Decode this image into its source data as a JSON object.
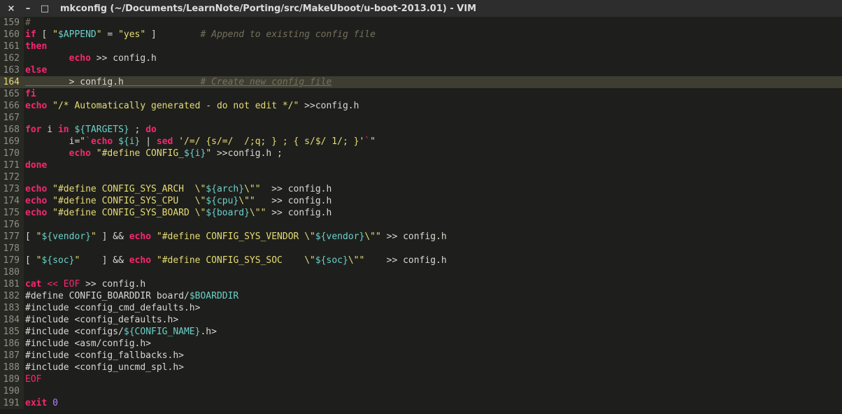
{
  "titlebar": {
    "close": "×",
    "min": "–",
    "max": "□",
    "title": "mkconfig (~/Documents/LearnNote/Porting/src/MakeUboot/u-boot-2013.01) - VIM"
  },
  "current_line": 164,
  "lines": [
    {
      "n": 159,
      "tokens": [
        [
          "cmt",
          "#"
        ]
      ]
    },
    {
      "n": 160,
      "tokens": [
        [
          "kw",
          "if"
        ],
        [
          "punct",
          " [ "
        ],
        [
          "str",
          "\""
        ],
        [
          "var",
          "$APPEND"
        ],
        [
          "str",
          "\""
        ],
        [
          "punct",
          " = "
        ],
        [
          "str",
          "\"yes\""
        ],
        [
          "punct",
          " ]        "
        ],
        [
          "cmt",
          "# Append to existing config file"
        ]
      ]
    },
    {
      "n": 161,
      "tokens": [
        [
          "kw",
          "then"
        ]
      ]
    },
    {
      "n": 162,
      "tokens": [
        [
          "punct",
          "        "
        ],
        [
          "kw",
          "echo"
        ],
        [
          "punct",
          " >> config.h"
        ]
      ]
    },
    {
      "n": 163,
      "tokens": [
        [
          "kw",
          "else"
        ]
      ]
    },
    {
      "n": 164,
      "tokens": [
        [
          "punct",
          "        > config.h              "
        ],
        [
          "cmt",
          "# Create new config file"
        ]
      ]
    },
    {
      "n": 165,
      "tokens": [
        [
          "kw",
          "fi"
        ]
      ]
    },
    {
      "n": 166,
      "tokens": [
        [
          "kw",
          "echo"
        ],
        [
          "punct",
          " "
        ],
        [
          "str",
          "\"/* Automatically generated - do not edit */\""
        ],
        [
          "punct",
          " >>config.h"
        ]
      ]
    },
    {
      "n": 167,
      "tokens": []
    },
    {
      "n": 168,
      "tokens": [
        [
          "kw",
          "for"
        ],
        [
          "punct",
          " i "
        ],
        [
          "kw",
          "in"
        ],
        [
          "punct",
          " "
        ],
        [
          "var",
          "${TARGETS}"
        ],
        [
          "punct",
          " ; "
        ],
        [
          "kw",
          "do"
        ]
      ]
    },
    {
      "n": 169,
      "tokens": [
        [
          "punct",
          "        i="
        ],
        [
          "str",
          "\""
        ],
        [
          "red",
          "`"
        ],
        [
          "kw",
          "echo"
        ],
        [
          "punct",
          " "
        ],
        [
          "var",
          "${i}"
        ],
        [
          "punct",
          " | "
        ],
        [
          "kw",
          "sed"
        ],
        [
          "punct",
          " "
        ],
        [
          "str",
          "'/=/ {s/=/\t/;q; } ; { s/$/ 1/; }'"
        ],
        [
          "red",
          "`"
        ],
        [
          "str",
          "\""
        ]
      ]
    },
    {
      "n": 170,
      "tokens": [
        [
          "punct",
          "        "
        ],
        [
          "kw",
          "echo"
        ],
        [
          "punct",
          " "
        ],
        [
          "str",
          "\"#define CONFIG_"
        ],
        [
          "var",
          "${i}"
        ],
        [
          "str",
          "\""
        ],
        [
          "punct",
          " >>config.h ;"
        ]
      ]
    },
    {
      "n": 171,
      "tokens": [
        [
          "kw",
          "done"
        ]
      ]
    },
    {
      "n": 172,
      "tokens": []
    },
    {
      "n": 173,
      "tokens": [
        [
          "kw",
          "echo"
        ],
        [
          "punct",
          " "
        ],
        [
          "str",
          "\"#define CONFIG_SYS_ARCH  \\\""
        ],
        [
          "var",
          "${arch}"
        ],
        [
          "str",
          "\\\"\""
        ],
        [
          "punct",
          "  >> config.h"
        ]
      ]
    },
    {
      "n": 174,
      "tokens": [
        [
          "kw",
          "echo"
        ],
        [
          "punct",
          " "
        ],
        [
          "str",
          "\"#define CONFIG_SYS_CPU   \\\""
        ],
        [
          "var",
          "${cpu}"
        ],
        [
          "str",
          "\\\"\""
        ],
        [
          "punct",
          "   >> config.h"
        ]
      ]
    },
    {
      "n": 175,
      "tokens": [
        [
          "kw",
          "echo"
        ],
        [
          "punct",
          " "
        ],
        [
          "str",
          "\"#define CONFIG_SYS_BOARD \\\""
        ],
        [
          "var",
          "${board}"
        ],
        [
          "str",
          "\\\"\""
        ],
        [
          "punct",
          " >> config.h"
        ]
      ]
    },
    {
      "n": 176,
      "tokens": []
    },
    {
      "n": 177,
      "tokens": [
        [
          "punct",
          "[ "
        ],
        [
          "str",
          "\""
        ],
        [
          "var",
          "${vendor}"
        ],
        [
          "str",
          "\""
        ],
        [
          "punct",
          " ] && "
        ],
        [
          "kw",
          "echo"
        ],
        [
          "punct",
          " "
        ],
        [
          "str",
          "\"#define CONFIG_SYS_VENDOR \\\""
        ],
        [
          "var",
          "${vendor}"
        ],
        [
          "str",
          "\\\"\""
        ],
        [
          "punct",
          " >> config.h"
        ]
      ]
    },
    {
      "n": 178,
      "tokens": []
    },
    {
      "n": 179,
      "tokens": [
        [
          "punct",
          "[ "
        ],
        [
          "str",
          "\""
        ],
        [
          "var",
          "${soc}"
        ],
        [
          "str",
          "\""
        ],
        [
          "punct",
          "    ] && "
        ],
        [
          "kw",
          "echo"
        ],
        [
          "punct",
          " "
        ],
        [
          "str",
          "\"#define CONFIG_SYS_SOC    \\\""
        ],
        [
          "var",
          "${soc}"
        ],
        [
          "str",
          "\\\"\""
        ],
        [
          "punct",
          "    >> config.h"
        ]
      ]
    },
    {
      "n": 180,
      "tokens": []
    },
    {
      "n": 181,
      "tokens": [
        [
          "kw",
          "cat"
        ],
        [
          "punct",
          " "
        ],
        [
          "op",
          "<<"
        ],
        [
          "punct",
          " "
        ],
        [
          "red",
          "EOF"
        ],
        [
          "punct",
          " >> config.h"
        ]
      ]
    },
    {
      "n": 182,
      "tokens": [
        [
          "punct",
          "#define CONFIG_BOARDDIR board/"
        ],
        [
          "var",
          "$BOARDDIR"
        ]
      ]
    },
    {
      "n": 183,
      "tokens": [
        [
          "punct",
          "#include <config_cmd_defaults.h>"
        ]
      ]
    },
    {
      "n": 184,
      "tokens": [
        [
          "punct",
          "#include <config_defaults.h>"
        ]
      ]
    },
    {
      "n": 185,
      "tokens": [
        [
          "punct",
          "#include <configs/"
        ],
        [
          "var",
          "${CONFIG_NAME}"
        ],
        [
          "punct",
          ".h>"
        ]
      ]
    },
    {
      "n": 186,
      "tokens": [
        [
          "punct",
          "#include <asm/config.h>"
        ]
      ]
    },
    {
      "n": 187,
      "tokens": [
        [
          "punct",
          "#include <config_fallbacks.h>"
        ]
      ]
    },
    {
      "n": 188,
      "tokens": [
        [
          "punct",
          "#include <config_uncmd_spl.h>"
        ]
      ]
    },
    {
      "n": 189,
      "tokens": [
        [
          "red",
          "EOF"
        ]
      ]
    },
    {
      "n": 190,
      "tokens": []
    },
    {
      "n": 191,
      "tokens": [
        [
          "kw",
          "exit"
        ],
        [
          "punct",
          " "
        ],
        [
          "num",
          "0"
        ]
      ]
    }
  ]
}
